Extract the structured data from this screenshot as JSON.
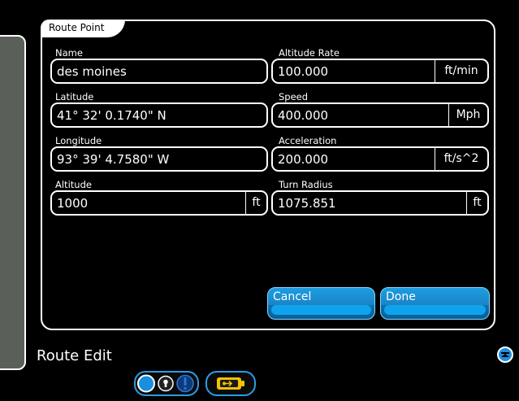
{
  "dialog": {
    "tab_label": "Route Point",
    "fields": {
      "name": {
        "label": "Name",
        "value": "des moines"
      },
      "latitude": {
        "label": "Latitude",
        "value": "41° 32' 0.1740\" N"
      },
      "longitude": {
        "label": "Longitude",
        "value": "93° 39' 4.7580\" W"
      },
      "altitude": {
        "label": "Altitude",
        "value": "1000",
        "unit": "ft"
      },
      "altitude_rate": {
        "label": "Altitude Rate",
        "value": "100.000",
        "unit": "ft/min"
      },
      "speed": {
        "label": "Speed",
        "value": "400.000",
        "unit": "Mph"
      },
      "acceleration": {
        "label": "Acceleration",
        "value": "200.000",
        "unit": "ft/s^2"
      },
      "turn_radius": {
        "label": "Turn Radius",
        "value": "1075.851",
        "unit": "ft"
      }
    },
    "buttons": {
      "cancel": "Cancel",
      "done": "Done"
    }
  },
  "footer": {
    "title": "Route Edit"
  },
  "icons": {
    "scroll_up": "chevron-up-icon",
    "status_circle": "circle-icon",
    "lock": "lock-icon",
    "alert": "exclamation-icon",
    "battery": "battery-icon"
  },
  "colors": {
    "accent": "#1a8fe0",
    "panel": "#5a5f59",
    "battery": "#f2c200"
  }
}
